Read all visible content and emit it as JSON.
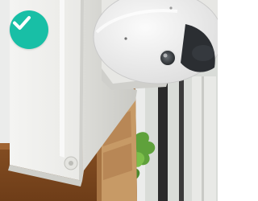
{
  "photo": {
    "subject_icon": "camera-on-enclosure-photo"
  },
  "badge": {
    "icon": "checkmark-icon",
    "color": "#18bfa6",
    "check_color": "#ffffff"
  }
}
